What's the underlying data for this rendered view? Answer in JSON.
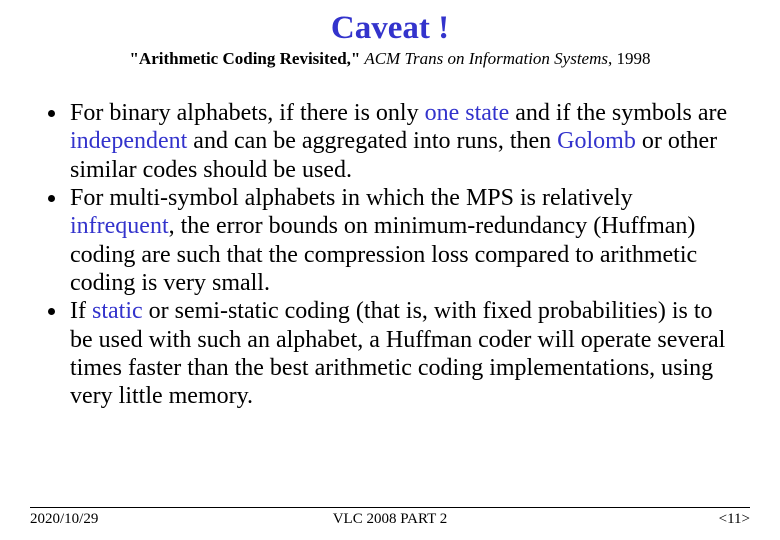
{
  "title": "Caveat !",
  "subtitle": {
    "quoted": "\"Arithmetic Coding Revisited,\"",
    "journal": " ACM  Trans on Information Systems",
    "year": ", 1998"
  },
  "bullets": {
    "b1": {
      "t1": "For binary alphabets, if there is only ",
      "u1": "one state",
      "t2": " and if the symbols are ",
      "u2": "independent",
      "t3": " and can be aggregated into runs, then ",
      "g": "Golomb",
      "t4": " or other similar codes should be used."
    },
    "b2": {
      "t1": "For multi-symbol alphabets in which the MPS is relatively ",
      "u1": "infrequent",
      "t2": ", the error bounds on minimum-redundancy (Huffman) coding are such that the compression loss compared to arithmetic coding is very small."
    },
    "b3": {
      "t1": "If ",
      "s1": "static",
      "t2": " or semi-static coding (that is, with fixed probabilities) is to be used with such an alphabet, a Huffman coder will operate several times faster than the best arithmetic coding implementations, using very little memory."
    }
  },
  "footer": {
    "date": "2020/10/29",
    "center": "VLC 2008 PART 2",
    "page": "<11>"
  }
}
